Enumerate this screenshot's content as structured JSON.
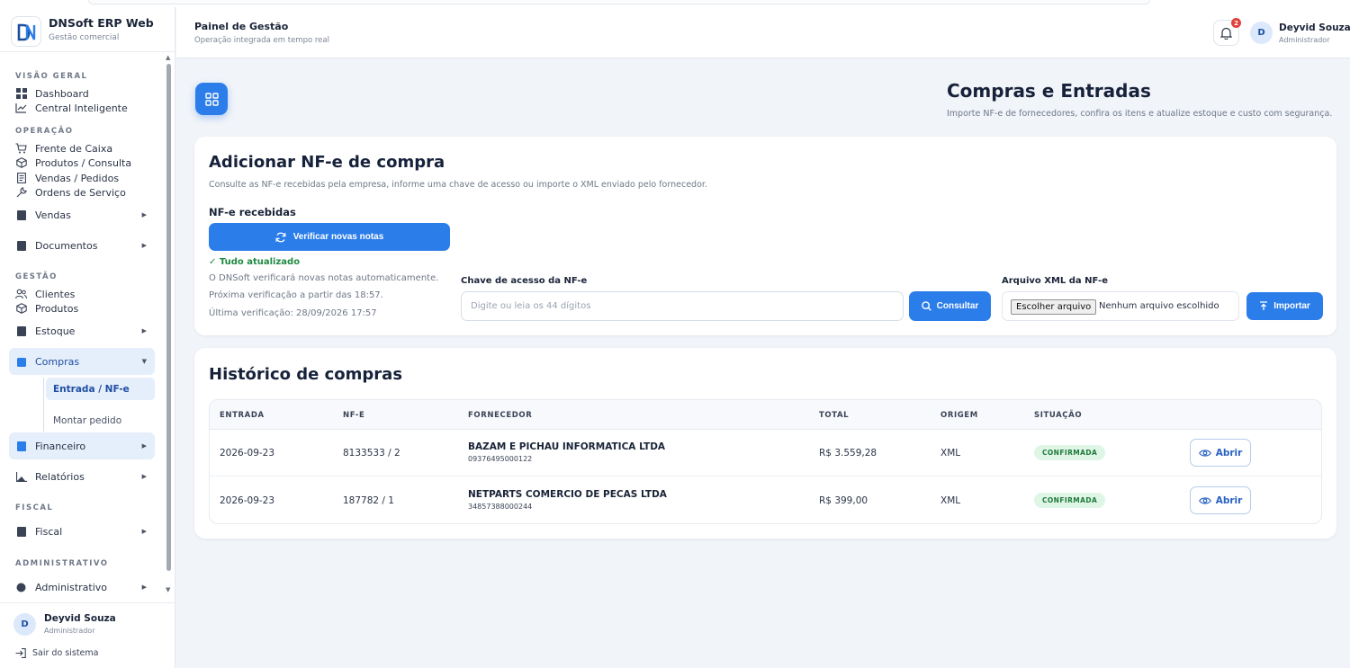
{
  "app": {
    "name": "DNSoft ERP Web",
    "subtitle": "Gestão comercial"
  },
  "sidebar": {
    "sections": {
      "overview": "VISÃO GERAL",
      "operation": "OPERAÇÃO",
      "management": "GESTÃO",
      "fiscal": "FISCAL",
      "admin": "ADMINISTRATIVO"
    },
    "items": {
      "dashboard": "Dashboard",
      "central": "Central Inteligente",
      "caixa": "Frente de Caixa",
      "produtos_consulta": "Produtos / Consulta",
      "vendas_pedidos": "Vendas / Pedidos",
      "ordens": "Ordens de Serviço",
      "vendas": "Vendas",
      "documentos": "Documentos",
      "clientes": "Clientes",
      "produtos": "Produtos",
      "estoque": "Estoque",
      "compras": "Compras",
      "entrada_nfe": "Entrada / NF-e",
      "montar_pedido": "Montar pedido",
      "financeiro": "Financeiro",
      "relatorios": "Relatórios",
      "fiscal": "Fiscal",
      "administrativo": "Administrativo"
    },
    "footer": {
      "user_initial": "D",
      "user_name": "Deyvid Souza",
      "user_role": "Administrador",
      "logout": "Sair do sistema"
    }
  },
  "header": {
    "title": "Painel de Gestão",
    "subtitle": "Operação integrada em tempo real",
    "notifications_count": "2",
    "user_initial": "D",
    "user_name": "Deyvid Souza",
    "user_role": "Administrador"
  },
  "page": {
    "title": "Compras e Entradas",
    "subtitle": "Importe NF-e de fornecedores, confira os itens e atualize estoque e custo com segurança."
  },
  "add_card": {
    "title": "Adicionar NF-e de compra",
    "subtitle": "Consulte as NF-e recebidas pela empresa, informe uma chave de acesso ou importe o XML enviado pelo fornecedor.",
    "received_label": "NF-e recebidas",
    "check_button": "Verificar novas notas",
    "status_ok": "✓ Tudo atualizado",
    "info_auto": "O DNSoft verificará novas notas automaticamente.",
    "info_next": "Próxima verificação a partir das 18:57.",
    "info_last": "Última verificação: 28/09/2026 17:57",
    "key_label": "Chave de acesso da NF-e",
    "key_placeholder": "Digite ou leia os 44 dígitos",
    "consult_button": "Consultar",
    "xml_label": "Arquivo XML da NF-e",
    "file_button": "Escolher arquivo",
    "file_status": "Nenhum arquivo escolhido",
    "import_button": "Importar"
  },
  "history": {
    "title": "Histórico de compras",
    "columns": {
      "entrada": "ENTRADA",
      "nfe": "NF-E",
      "fornecedor": "FORNECEDOR",
      "total": "TOTAL",
      "origem": "ORIGEM",
      "situacao": "SITUAÇÃO"
    },
    "rows": [
      {
        "entrada": "2026-09-23",
        "nfe": "8133533 / 2",
        "fornecedor": "BAZAM E PICHAU INFORMATICA LTDA",
        "cnpj": "09376495000122",
        "total": "R$ 3.559,28",
        "origem": "XML",
        "situacao": "CONFIRMADA",
        "action": "Abrir"
      },
      {
        "entrada": "2026-09-23",
        "nfe": "187782 / 1",
        "fornecedor": "NETPARTS COMERCIO DE PECAS LTDA",
        "cnpj": "34857388000244",
        "total": "R$ 399,00",
        "origem": "XML",
        "situacao": "CONFIRMADA",
        "action": "Abrir"
      }
    ]
  },
  "colors": {
    "accent": "#2b7de9",
    "success": "#1e8a42",
    "badge": "#e0423d"
  }
}
